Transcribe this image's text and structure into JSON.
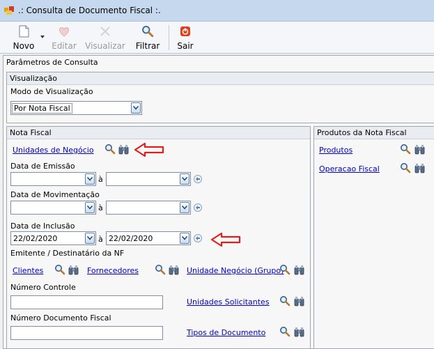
{
  "window": {
    "title": ".: Consulta de Documento Fiscal :."
  },
  "toolbar": {
    "novo": "Novo",
    "editar": "Editar",
    "visualizar": "Visualizar",
    "filtrar": "Filtrar",
    "sair": "Sair"
  },
  "params": {
    "title": "Parâmetros de Consulta"
  },
  "visualizacao": {
    "title": "Visualização",
    "mode_label": "Modo de Visualização",
    "mode_value": "Por Nota Fiscal"
  },
  "nota_fiscal": {
    "title": "Nota Fiscal",
    "unidades_link": "Unidades de Negócio",
    "emissao_label": "Data de Emissão",
    "movimentacao_label": "Data de Movimentação",
    "inclusao_label": "Data de Inclusão",
    "inclusao_from": "22/02/2020",
    "inclusao_to": "22/02/2020",
    "sep": "à",
    "emitente_label": "Emitente / Destinatário da NF",
    "clientes_link": "Clientes",
    "fornecedores_link": "Fornecedores",
    "unidade_grupo_link": "Unidade Negócio (Grupo)",
    "numero_controle_label": "Número Controle",
    "numero_controle_value": "",
    "unidades_solicitantes_link": "Unidades Solicitantes",
    "numero_doc_label": "Número Documento Fiscal",
    "numero_doc_value": "",
    "tipos_doc_link": "Tipos de Documento"
  },
  "produtos": {
    "title": "Produtos da Nota Fiscal",
    "produtos_link": "Produtos",
    "operacao_link": "Operacao Fiscal"
  },
  "colors": {
    "link": "#0000c8",
    "arrow": "#e0201c",
    "titlebar": "#c6d8ee"
  }
}
